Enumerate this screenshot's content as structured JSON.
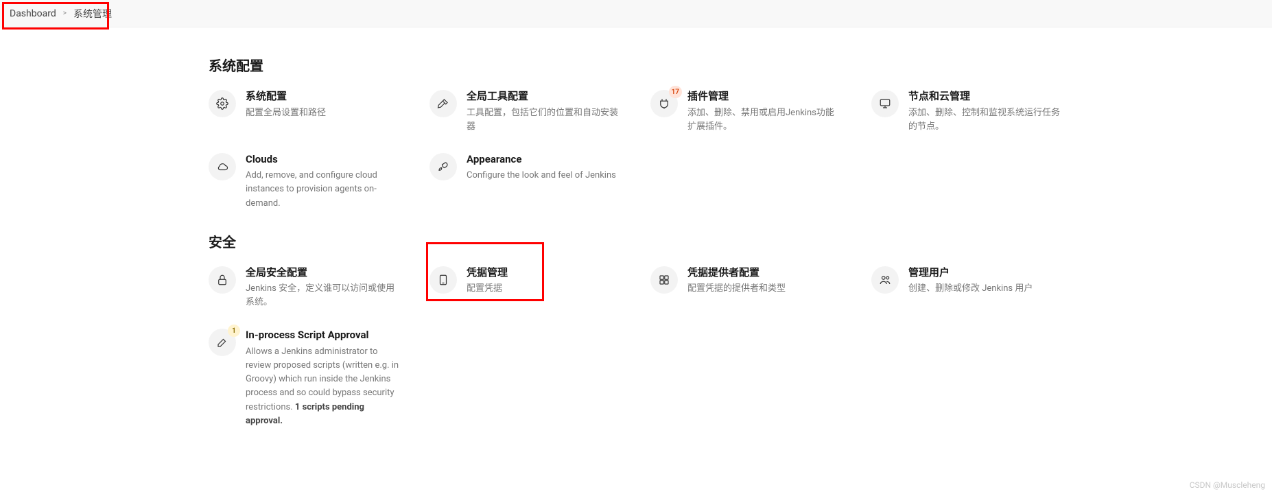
{
  "breadcrumb": {
    "items": [
      "Dashboard",
      "系统管理"
    ],
    "sep": ">"
  },
  "sections": [
    {
      "title": "系统配置",
      "cards": [
        {
          "icon": "gear",
          "title": "系统配置",
          "desc": "配置全局设置和路径"
        },
        {
          "icon": "hammer",
          "title": "全局工具配置",
          "desc": "工具配置，包括它们的位置和自动安装器"
        },
        {
          "icon": "plugin",
          "title": "插件管理",
          "desc": "添加、删除、禁用或启用Jenkins功能扩展插件。",
          "badge": "17",
          "badgeColor": "orange"
        },
        {
          "icon": "monitor",
          "title": "节点和云管理",
          "desc": "添加、删除、控制和监视系统运行任务的节点。"
        },
        {
          "icon": "cloud",
          "title": "Clouds",
          "desc": "Add, remove, and configure cloud instances to provision agents on-demand."
        },
        {
          "icon": "brush",
          "title": "Appearance",
          "desc": "Configure the look and feel of Jenkins"
        }
      ]
    },
    {
      "title": "安全",
      "cards": [
        {
          "icon": "lock",
          "title": "全局安全配置",
          "desc": "Jenkins 安全，定义谁可以访问或使用系统。"
        },
        {
          "icon": "phone",
          "title": "凭据管理",
          "desc": "配置凭据"
        },
        {
          "icon": "providers",
          "title": "凭据提供者配置",
          "desc": "配置凭据的提供者和类型"
        },
        {
          "icon": "users",
          "title": "管理用户",
          "desc": "创建、删除或修改 Jenkins 用户"
        },
        {
          "icon": "edit",
          "title": "In-process Script Approval",
          "desc": "Allows a Jenkins administrator to review proposed scripts (written e.g. in Groovy) which run inside the Jenkins process and so could bypass security restrictions. ",
          "descStrong": "1 scripts pending approval.",
          "badge": "1",
          "badgeColor": "yellow"
        }
      ]
    }
  ],
  "watermark": "CSDN @Muscleheng"
}
